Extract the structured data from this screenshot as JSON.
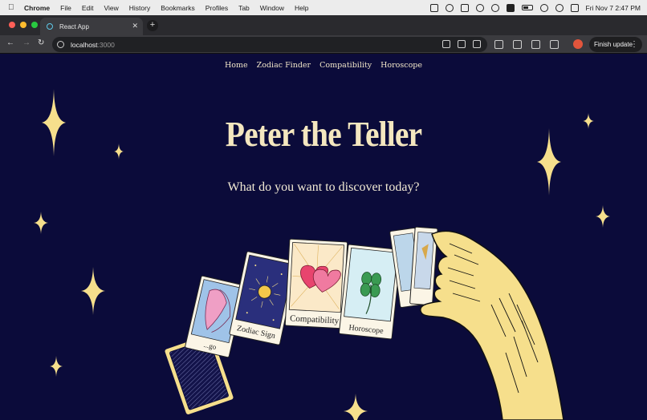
{
  "menubar": {
    "app": "Chrome",
    "items": [
      "File",
      "Edit",
      "View",
      "History",
      "Bookmarks",
      "Profiles",
      "Tab",
      "Window",
      "Help"
    ],
    "datetime": "Fri Nov 7  2:47 PM",
    "icons": [
      "apple-icon",
      "notes-icon",
      "drafts-icon",
      "notion-icon",
      "focus-icon",
      "play-icon",
      "hangul-icon",
      "battery-icon",
      "wifi-icon",
      "search-icon",
      "control-center-icon"
    ]
  },
  "browser": {
    "tab_title": "React App",
    "url_host": "localhost",
    "url_port": ":3000",
    "update_label": "Finish update"
  },
  "site": {
    "nav": [
      "Home",
      "Zodiac Finder",
      "Compatibility",
      "Horoscope"
    ],
    "title": "Peter the Teller",
    "subtitle": "What do you want to discover today?",
    "cards": [
      "...go",
      "Zodiac Sign",
      "Compatibility",
      "Horoscope"
    ],
    "colors": {
      "background": "#0b0b3a",
      "accent": "#f4e7bf",
      "hand": "#f6df8c",
      "card_face": "#fbf5e6"
    }
  }
}
